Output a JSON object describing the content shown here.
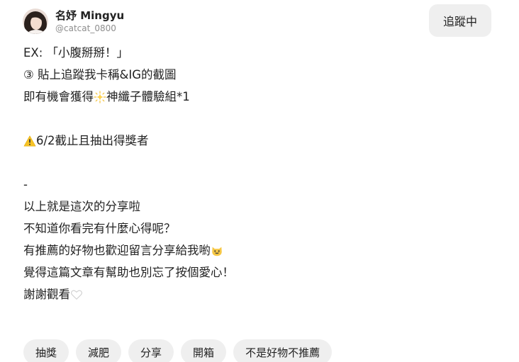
{
  "author": {
    "name": "名妤 Mingyu",
    "handle": "@catcat_0800"
  },
  "follow_button": {
    "label": "追蹤中"
  },
  "post": {
    "line_partial": "EX: 「小腹掰掰！」",
    "line_step3": "③ 貼上追蹤我卡稱&IG的截圖",
    "line_chance_before": "即有機會獲得",
    "line_chance_after": "神纖子體驗組*1",
    "line_deadline": "6/2截止且抽出得獎者",
    "line_dash": "-",
    "line_summary": "以上就是這次的分享啦",
    "line_question": "不知道你看完有什麼心得呢？",
    "line_recommend": "有推薦的好物也歡迎留言分享給我喲",
    "line_like": "覺得這篇文章有幫助也別忘了按個愛心！",
    "line_thanks": "謝謝觀看"
  },
  "emoji_icons": {
    "sparkle": "glowing-star-icon",
    "warning": "warning-icon",
    "cat": "grinning-cat-icon",
    "heart": "white-heart-icon"
  },
  "tags": [
    "抽獎",
    "減肥",
    "分享",
    "開箱",
    "不是好物不推薦"
  ],
  "colors": {
    "text": "#222222",
    "muted": "#8e8e8e",
    "button_bg": "#efefef"
  }
}
